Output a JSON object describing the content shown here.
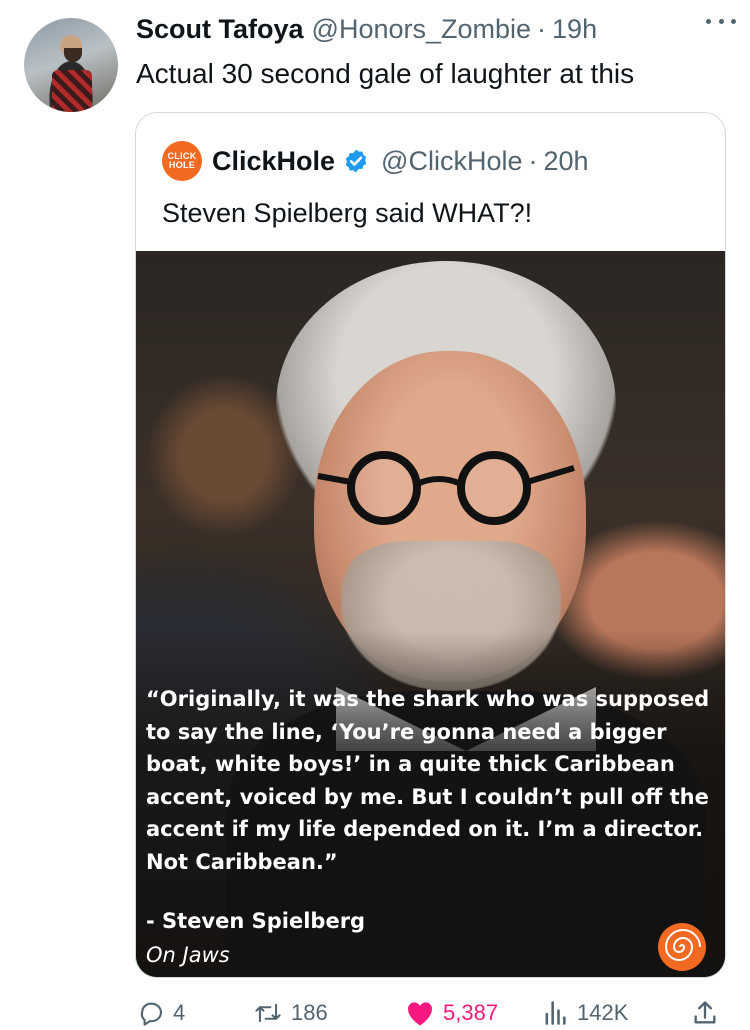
{
  "tweet": {
    "author": {
      "display_name": "Scout Tafoya",
      "handle": "@Honors_Zombie",
      "separator": "·",
      "time": "19h"
    },
    "text": "Actual 30 second gale of laughter at this",
    "more_icon": "ellipsis-icon"
  },
  "quoted": {
    "author": {
      "display_name": "ClickHole",
      "handle": "@ClickHole",
      "separator": "·",
      "time": "20h",
      "verified": true
    },
    "logo_lines": [
      "CLICK",
      "HOLE"
    ],
    "text": "Steven Spielberg said WHAT?!",
    "image": {
      "quote": "“Originally, it was the shark who was supposed to say the line, ‘You’re gonna need a bigger boat, white boys!’ in a quite thick Caribbean accent, voiced by me. But I couldn’t pull off the accent if my life depended on it. I’m a director. Not Caribbean.”",
      "attribution_name": "- Steven Spielberg",
      "attribution_work": "On Jaws"
    }
  },
  "actions": {
    "replies": "4",
    "reposts": "186",
    "likes": "5,387",
    "views": "142K"
  },
  "colors": {
    "like": "#f91880",
    "verified": "#1d9bf0",
    "clickhole": "#f26a21",
    "muted": "#536471"
  }
}
